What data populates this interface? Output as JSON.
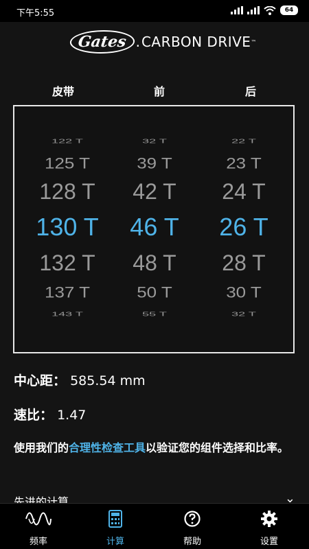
{
  "status_bar": {
    "time": "下午5:55",
    "battery": "64"
  },
  "header": {
    "logo_gates": "Gates",
    "logo_brand": "CARBON DRIVE",
    "logo_tm": "™"
  },
  "columns": {
    "belt": "皮带",
    "front": "前",
    "rear": "后"
  },
  "picker": {
    "belt": [
      "122 T",
      "125 T",
      "128 T",
      "130 T",
      "132 T",
      "137 T",
      "143 T"
    ],
    "front": [
      "32 T",
      "39 T",
      "42 T",
      "46 T",
      "48 T",
      "50 T",
      "55 T"
    ],
    "rear": [
      "22 T",
      "23 T",
      "24 T",
      "26 T",
      "28 T",
      "30 T",
      "32 T"
    ],
    "selected_index": 3
  },
  "info": {
    "center_distance_label": "中心距：",
    "center_distance_value": "585.54 mm",
    "ratio_label": "速比：",
    "ratio_value": "1.47"
  },
  "note": {
    "prefix": "使用我们的",
    "link": "合理性检查工具",
    "suffix": "以验证您的组件选择和比率。"
  },
  "advanced": {
    "label": "先进的计算"
  },
  "nav": {
    "items": [
      {
        "label": "频率",
        "icon": "wave-icon"
      },
      {
        "label": "计算",
        "icon": "calculator-icon"
      },
      {
        "label": "帮助",
        "icon": "help-icon"
      },
      {
        "label": "设置",
        "icon": "gear-icon"
      }
    ],
    "active_index": 1,
    "accent_color": "#4fb3e8"
  }
}
